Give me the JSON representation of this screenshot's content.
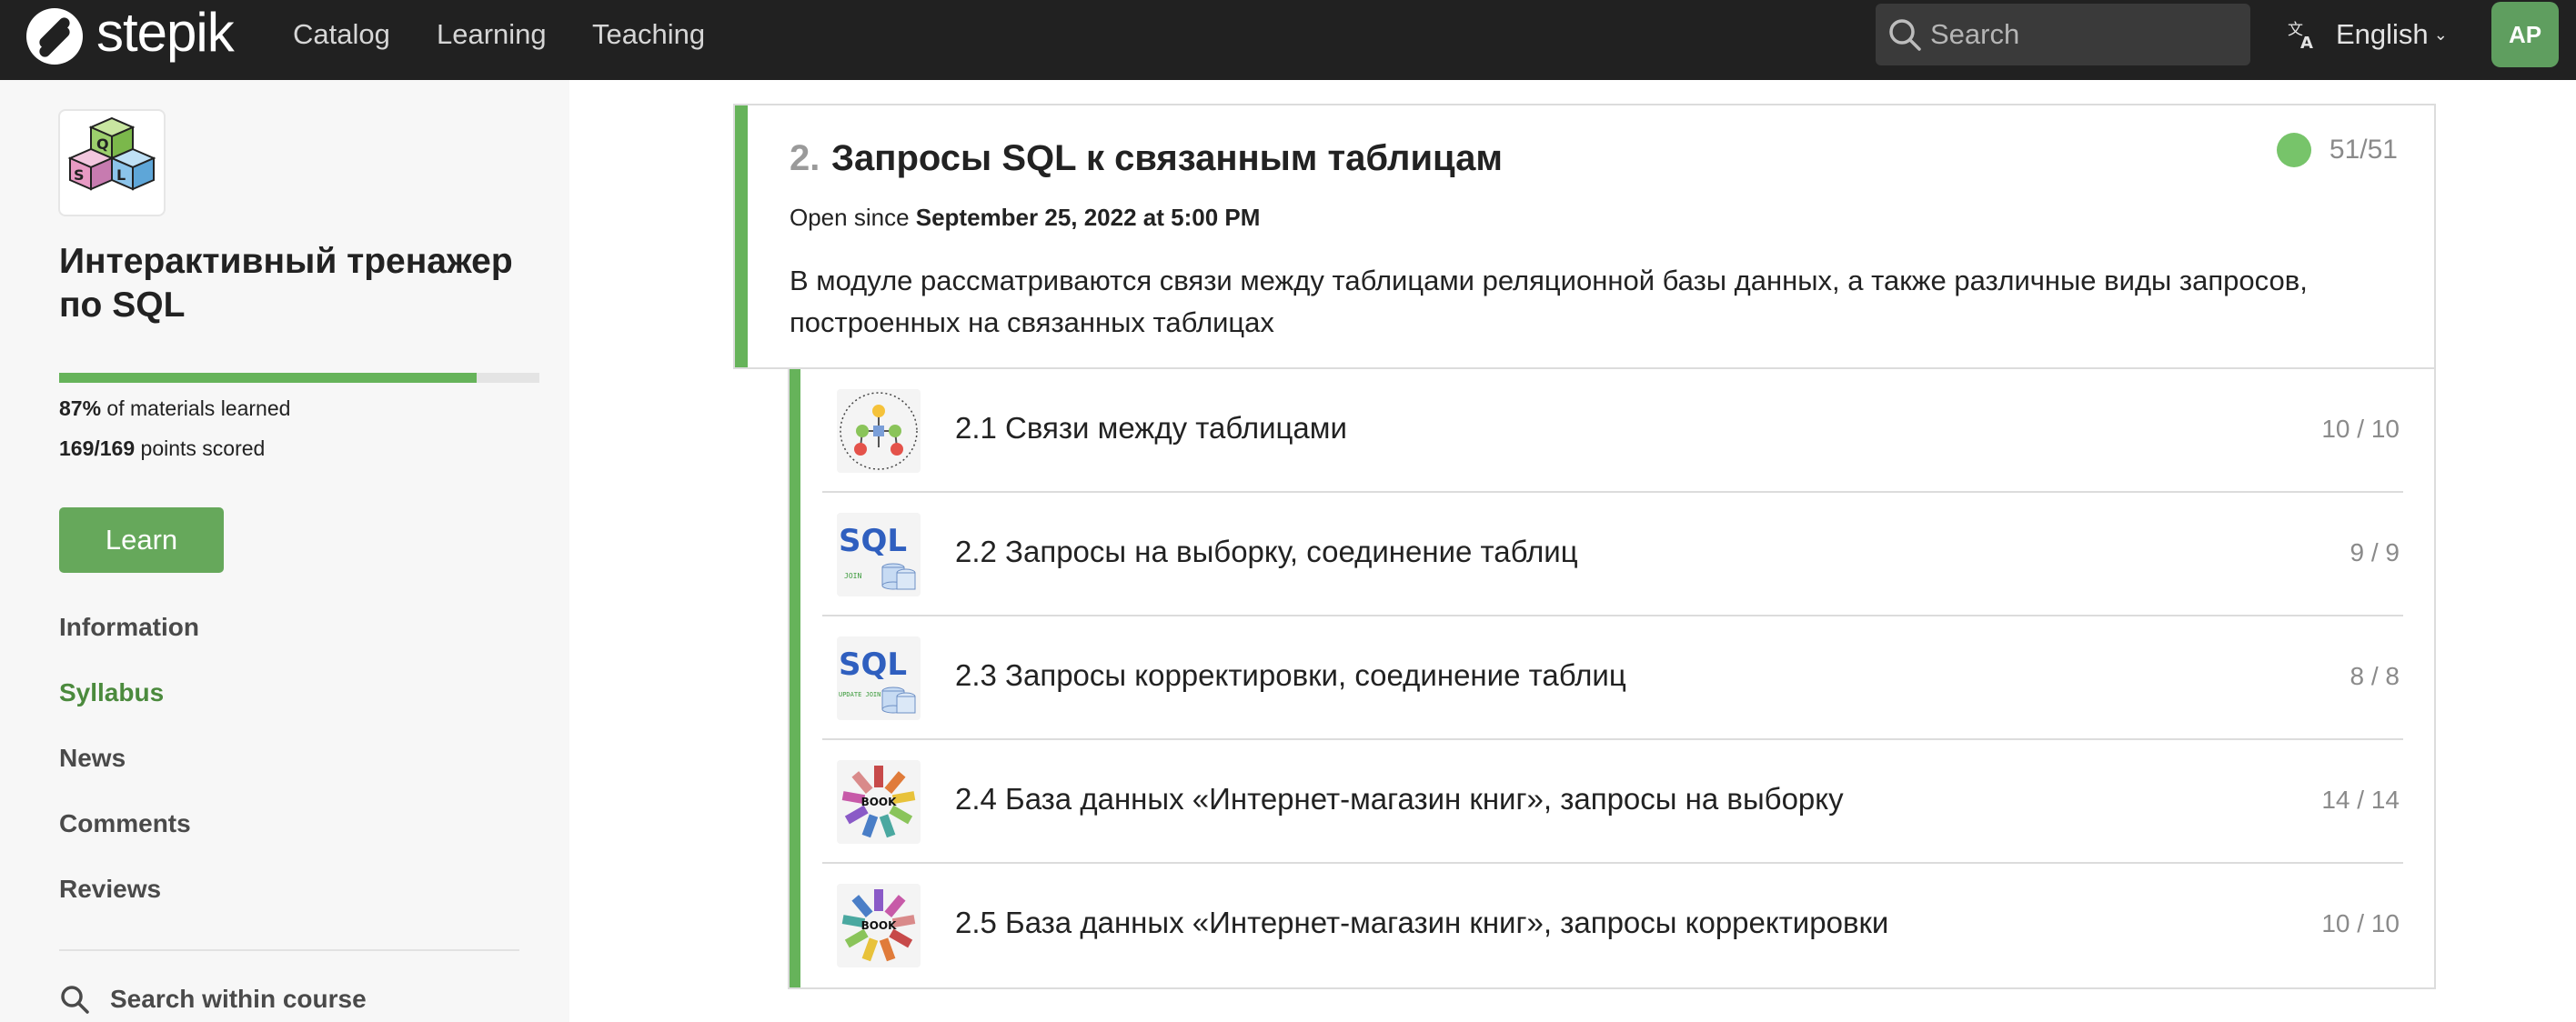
{
  "navbar": {
    "brand": "stepik",
    "links": [
      "Catalog",
      "Learning",
      "Teaching"
    ],
    "search_placeholder": "Search",
    "language": "English",
    "avatar_initials": "AP"
  },
  "sidebar": {
    "course_title": "Интерактивный тренажер по SQL",
    "progress_percent": 87,
    "progress_label_value": "87%",
    "progress_label_text": " of materials learned",
    "points_value": "169/169",
    "points_text": " points scored",
    "learn_button": "Learn",
    "nav_items": [
      {
        "label": "Information"
      },
      {
        "label": "Syllabus"
      },
      {
        "label": "News"
      },
      {
        "label": "Comments"
      },
      {
        "label": "Reviews"
      }
    ],
    "search_within": "Search within course"
  },
  "module": {
    "number": "2.",
    "title": "Запросы SQL к связанным таблицам",
    "status_count": "51/51",
    "open_since_prefix": "Open since ",
    "open_since_date": "September 25, 2022 at 5:00 PM",
    "description": "В модуле рассматриваются связи между таблицами реляционной базы данных, а также различные виды запросов, построенных на связанных таблицах",
    "accent_color": "#66b35a"
  },
  "lessons": [
    {
      "title": "2.1 Связи между таблицами",
      "score": "10 / 10",
      "icon": "network-icon"
    },
    {
      "title": "2.2 Запросы на выборку, соединение таблиц",
      "score": "9 / 9",
      "icon": "sql-join-icon",
      "thumb_text": "SQL",
      "thumb_sub": "JOIN"
    },
    {
      "title": "2.3 Запросы корректировки, соединение таблиц",
      "score": "8 / 8",
      "icon": "sql-update-icon",
      "thumb_text": "SQL",
      "thumb_sub": "UPDATE JOIN"
    },
    {
      "title": "2.4 База данных «Интернет-магазин книг», запросы на выборку",
      "score": "14 / 14",
      "icon": "book-icon",
      "thumb_text": "BOOK"
    },
    {
      "title": "2.5 База данных «Интернет-магазин книг», запросы корректировки",
      "score": "10 / 10",
      "icon": "book-icon",
      "thumb_text": "BOOK"
    }
  ]
}
